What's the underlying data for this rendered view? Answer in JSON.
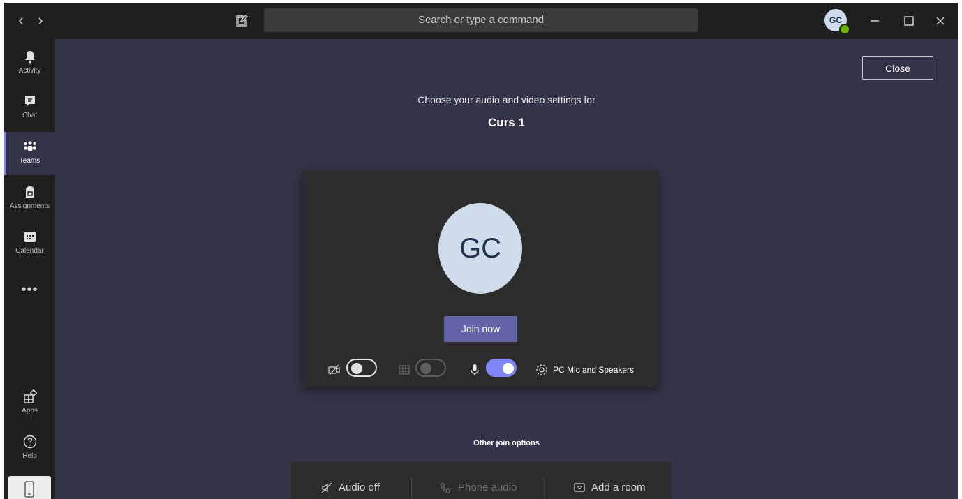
{
  "titlebar": {
    "back_icon": "‹",
    "forward_icon": "›",
    "search_placeholder": "Search or type a command",
    "avatar_initials": "GC"
  },
  "rail": {
    "items": [
      {
        "label": "Activity",
        "icon": "bell-icon"
      },
      {
        "label": "Chat",
        "icon": "chat-icon"
      },
      {
        "label": "Teams",
        "icon": "teams-icon"
      },
      {
        "label": "Assignments",
        "icon": "assignments-icon"
      },
      {
        "label": "Calendar",
        "icon": "calendar-icon"
      }
    ],
    "more": "•••",
    "bottom": [
      {
        "label": "Apps",
        "icon": "apps-icon"
      },
      {
        "label": "Help",
        "icon": "help-icon"
      }
    ],
    "active": "Teams"
  },
  "main": {
    "close_label": "Close",
    "subtitle": "Choose your audio and video settings for",
    "meeting_title": "Curs 1",
    "preview": {
      "avatar_initials": "GC",
      "join_label": "Join now",
      "device_label": "PC Mic and Speakers"
    },
    "other_options_label": "Other join options",
    "other_options": [
      {
        "label": "Audio off"
      },
      {
        "label": "Phone audio"
      },
      {
        "label": "Add a room"
      }
    ]
  },
  "colors": {
    "accent": "#6264a7",
    "toggle_on": "#7f85f5",
    "background": "#33344a",
    "chrome": "#1f1f1f"
  }
}
